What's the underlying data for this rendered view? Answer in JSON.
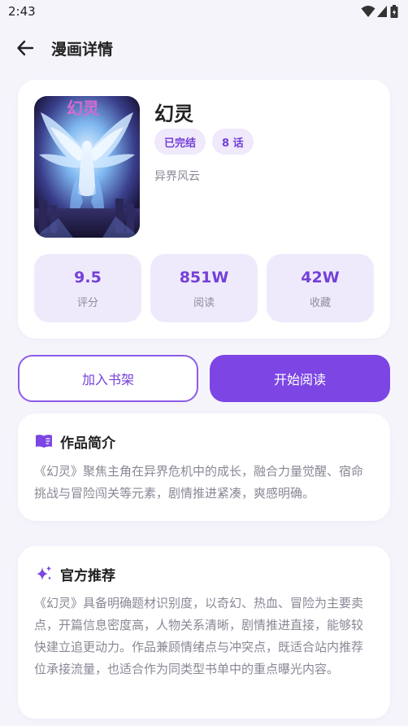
{
  "status_bar": {
    "time": "2:43"
  },
  "header": {
    "title": "漫画详情"
  },
  "comic": {
    "title": "幻灵",
    "cover_title": "幻灵",
    "tags": [
      "已完结",
      "8 话"
    ],
    "author": "异界风云"
  },
  "stats": [
    {
      "value": "9.5",
      "label": "评分"
    },
    {
      "value": "851W",
      "label": "阅读"
    },
    {
      "value": "42W",
      "label": "收藏"
    }
  ],
  "actions": {
    "add_shelf": "加入书架",
    "start_reading": "开始阅读"
  },
  "intro": {
    "title": "作品简介",
    "text": "《幻灵》聚焦主角在异界危机中的成长，融合力量觉醒、宿命挑战与冒险闯关等元素，剧情推进紧凑，爽感明确。"
  },
  "recommend": {
    "title": "官方推荐",
    "text": "《幻灵》具备明确题材识别度，以奇幻、热血、冒险为主要卖点，开篇信息密度高，人物关系清晰，剧情推进直接，能够较快建立追更动力。作品兼顾情绪点与冲突点，既适合站内推荐位承接流量，也适合作为同类型书单中的重点曝光内容。"
  },
  "colors": {
    "accent": "#7c45e4",
    "accent_light": "#efeafb",
    "background": "#f6f4fb"
  },
  "icons": [
    "arrow-back-icon",
    "wifi-icon",
    "signal-icon",
    "battery-icon",
    "book-icon",
    "sparkle-icon"
  ]
}
